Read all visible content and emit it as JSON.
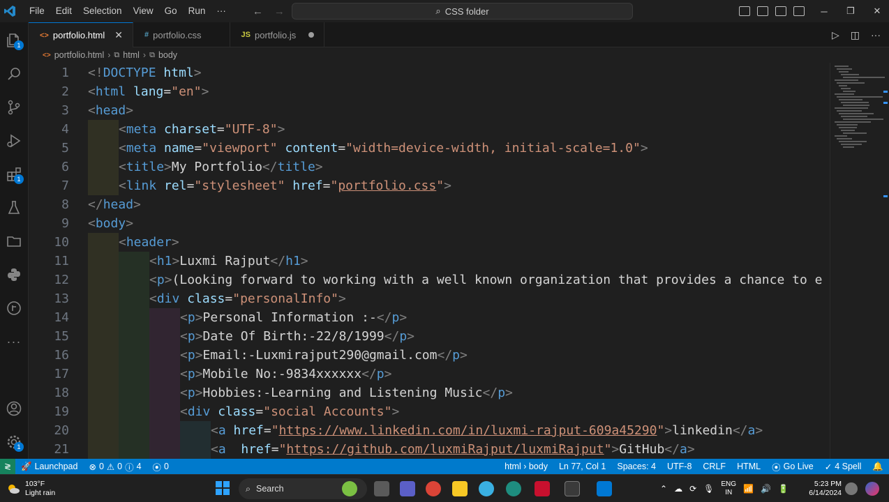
{
  "menu": [
    "File",
    "Edit",
    "Selection",
    "View",
    "Go",
    "Run",
    "···"
  ],
  "command_center": "CSS folder",
  "tabs": [
    {
      "label": "portfolio.html",
      "icon": "<>",
      "active": true
    },
    {
      "label": "portfolio.css",
      "icon": "#",
      "active": false
    },
    {
      "label": "portfolio.js",
      "icon": "JS",
      "active": false,
      "dirty": true
    }
  ],
  "breadcrumb": [
    "portfolio.html",
    "html",
    "body"
  ],
  "badges": {
    "source_control": "1",
    "extensions": "1",
    "settings": "1"
  },
  "code_lines": [
    {
      "n": "1",
      "indent": 0,
      "html": "<span class='t'>&lt;!</span><span class='tg'>DOCTYPE</span> <span class='at'>html</span><span class='t'>&gt;</span>"
    },
    {
      "n": "2",
      "indent": 0,
      "html": "<span class='t'>&lt;</span><span class='tg'>html</span> <span class='at'>lang</span><span class='tx'>=</span><span class='st'>\"en\"</span><span class='t'>&gt;</span>"
    },
    {
      "n": "3",
      "indent": 0,
      "html": "<span class='t'>&lt;</span><span class='tg'>head</span><span class='t'>&gt;</span>"
    },
    {
      "n": "4",
      "indent": 1,
      "html": "<span class='t'>&lt;</span><span class='tg'>meta</span> <span class='at'>charset</span><span class='tx'>=</span><span class='st'>\"UTF-8\"</span><span class='t'>&gt;</span>"
    },
    {
      "n": "5",
      "indent": 1,
      "html": "<span class='t'>&lt;</span><span class='tg'>meta</span> <span class='at'>name</span><span class='tx'>=</span><span class='st'>\"viewport\"</span> <span class='at'>content</span><span class='tx'>=</span><span class='st'>\"width=device-width, initial-scale=1.0\"</span><span class='t'>&gt;</span>"
    },
    {
      "n": "6",
      "indent": 1,
      "html": "<span class='t'>&lt;</span><span class='tg'>title</span><span class='t'>&gt;</span><span class='tx'>My Portfolio</span><span class='t'>&lt;/</span><span class='tg'>title</span><span class='t'>&gt;</span>"
    },
    {
      "n": "7",
      "indent": 1,
      "html": "<span class='t'>&lt;</span><span class='tg'>link</span> <span class='at'>rel</span><span class='tx'>=</span><span class='st'>\"stylesheet\"</span> <span class='at'>href</span><span class='tx'>=</span><span class='st'>\"<span class='u'>portfolio.css</span>\"</span><span class='t'>&gt;</span>"
    },
    {
      "n": "8",
      "indent": 0,
      "html": "<span class='t'>&lt;/</span><span class='tg'>head</span><span class='t'>&gt;</span>"
    },
    {
      "n": "9",
      "indent": 0,
      "html": "<span class='t'>&lt;</span><span class='tg'>body</span><span class='t'>&gt;</span>"
    },
    {
      "n": "10",
      "indent": 1,
      "html": "<span class='t'>&lt;</span><span class='tg'>header</span><span class='t'>&gt;</span>"
    },
    {
      "n": "11",
      "indent": 2,
      "html": "<span class='t'>&lt;</span><span class='tg'>h1</span><span class='t'>&gt;</span><span class='tx'>Luxmi Rajput</span><span class='t'>&lt;/</span><span class='tg'>h1</span><span class='t'>&gt;</span>"
    },
    {
      "n": "12",
      "indent": 2,
      "html": "<span class='t'>&lt;</span><span class='tg'>p</span><span class='t'>&gt;</span><span class='tx'>(Looking forward to working with a well known organization that provides a chance to e</span>"
    },
    {
      "n": "13",
      "indent": 2,
      "html": "<span class='t'>&lt;</span><span class='tg'>div</span> <span class='at'>class</span><span class='tx'>=</span><span class='st'>\"personalInfo\"</span><span class='t'>&gt;</span>"
    },
    {
      "n": "14",
      "indent": 3,
      "html": "<span class='t'>&lt;</span><span class='tg'>p</span><span class='t'>&gt;</span><span class='tx'>Personal Information :-</span><span class='t'>&lt;/</span><span class='tg'>p</span><span class='t'>&gt;</span>"
    },
    {
      "n": "15",
      "indent": 3,
      "html": "<span class='t'>&lt;</span><span class='tg'>p</span><span class='t'>&gt;</span><span class='tx'>Date Of Birth:-22/8/1999</span><span class='t'>&lt;/</span><span class='tg'>p</span><span class='t'>&gt;</span>"
    },
    {
      "n": "16",
      "indent": 3,
      "html": "<span class='t'>&lt;</span><span class='tg'>p</span><span class='t'>&gt;</span><span class='tx'>Email:-Luxmirajput290@gmail.com</span><span class='t'>&lt;/</span><span class='tg'>p</span><span class='t'>&gt;</span>"
    },
    {
      "n": "17",
      "indent": 3,
      "html": "<span class='t'>&lt;</span><span class='tg'>p</span><span class='t'>&gt;</span><span class='tx'>Mobile No:-9834xxxxxx</span><span class='t'>&lt;/</span><span class='tg'>p</span><span class='t'>&gt;</span>"
    },
    {
      "n": "18",
      "indent": 3,
      "html": "<span class='t'>&lt;</span><span class='tg'>p</span><span class='t'>&gt;</span><span class='tx'>Hobbies:-Learning and Listening Music</span><span class='t'>&lt;/</span><span class='tg'>p</span><span class='t'>&gt;</span>"
    },
    {
      "n": "19",
      "indent": 3,
      "html": "<span class='t'>&lt;</span><span class='tg'>div</span> <span class='at'>class</span><span class='tx'>=</span><span class='st'>\"social Accounts\"</span><span class='t'>&gt;</span>"
    },
    {
      "n": "20",
      "indent": 4,
      "html": "<span class='t'>&lt;</span><span class='tg'>a</span> <span class='at'>href</span><span class='tx'>=</span><span class='st'>\"<span class='u'>https://www.linkedin.com/in/luxmi-rajput-609a45290</span>\"</span><span class='t'>&gt;</span><span class='tx'>linkedin</span><span class='t'>&lt;/</span><span class='tg'>a</span><span class='t'>&gt;</span>"
    },
    {
      "n": "21",
      "indent": 4,
      "html": "<span class='t'>&lt;</span><span class='tg'>a</span>  <span class='at'>href</span><span class='tx'>=</span><span class='st'>\"<span class='u'>https://github.com/luxmiRajput/luxmiRajput</span>\"</span><span class='t'>&gt;</span><span class='tx'>GitHub</span><span class='t'>&lt;/</span><span class='tg'>a</span><span class='t'>&gt;</span>"
    }
  ],
  "status": {
    "launchpad": "Launchpad",
    "errors": "0",
    "warnings": "0",
    "info": "4",
    "ports": "0",
    "breadcrumb": "html › body",
    "position": "Ln 77, Col 1",
    "spaces": "Spaces: 4",
    "encoding": "UTF-8",
    "eol": "CRLF",
    "language": "HTML",
    "golive": "Go Live",
    "spell": "4 Spell"
  },
  "taskbar": {
    "temp": "103°F",
    "weather": "Light rain",
    "search": "Search",
    "lang1": "ENG",
    "lang2": "IN",
    "time": "5:23 PM",
    "date": "6/14/2024"
  }
}
